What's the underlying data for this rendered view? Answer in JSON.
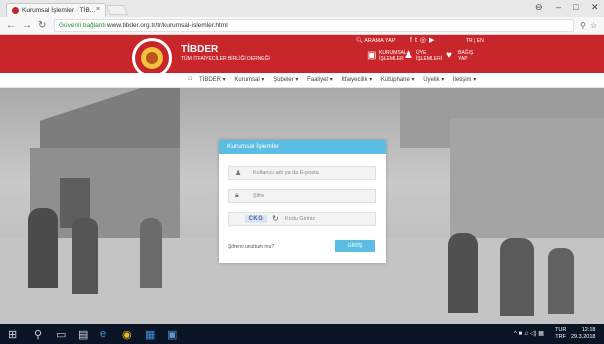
{
  "browser": {
    "tab_title": "Kurumsal İşlemler · TİB...",
    "tab_close": "×",
    "secure_label": "Güvenli bağlantı",
    "url": "www.tibder.org.tr/tr/kurumsal-islemler.html",
    "window_controls": [
      "–",
      "□",
      "✕"
    ],
    "profile_icon": "person-icon"
  },
  "site": {
    "name": "TİBDER",
    "subtitle": "TÜM İTFAİYECİLER BİRLİĞİ DERNEĞİ",
    "search_label": "ARAMA YAP",
    "language": "TR  |  EN",
    "header_links": [
      {
        "line1": "KURUMSAL",
        "line2": "İŞLEMLER"
      },
      {
        "line1": "ÜYE",
        "line2": "İŞLEMLERİ"
      },
      {
        "line1": "BAĞIŞ",
        "line2": "YAP"
      }
    ],
    "social_icons": [
      "facebook-icon",
      "twitter-icon",
      "instagram-icon",
      "youtube-icon"
    ]
  },
  "nav": {
    "items": [
      "TİBDER ▾",
      "Kurumsal ▾",
      "Şubeler ▾",
      "Faaliyet ▾",
      "İtfaiyecilik ▾",
      "Kütüphane ▾",
      "Üyelik ▾",
      "İletişim ▾"
    ]
  },
  "login": {
    "title": "Kurumsal İşlemler",
    "username_placeholder": "Kullanıcı adı ya da E-posta",
    "password_placeholder": "Şifre",
    "captcha_text": "CKG",
    "captcha_placeholder": "Kodu Giriniz",
    "forgot_label": "Şifremi unuttum mu?",
    "submit_label": "GİRİŞ"
  },
  "taskbar": {
    "tray": "^ ■ ♫ ◁) ▦",
    "lang": "TUR\nTRF",
    "time": "12:18",
    "date": "29.3.2018"
  }
}
